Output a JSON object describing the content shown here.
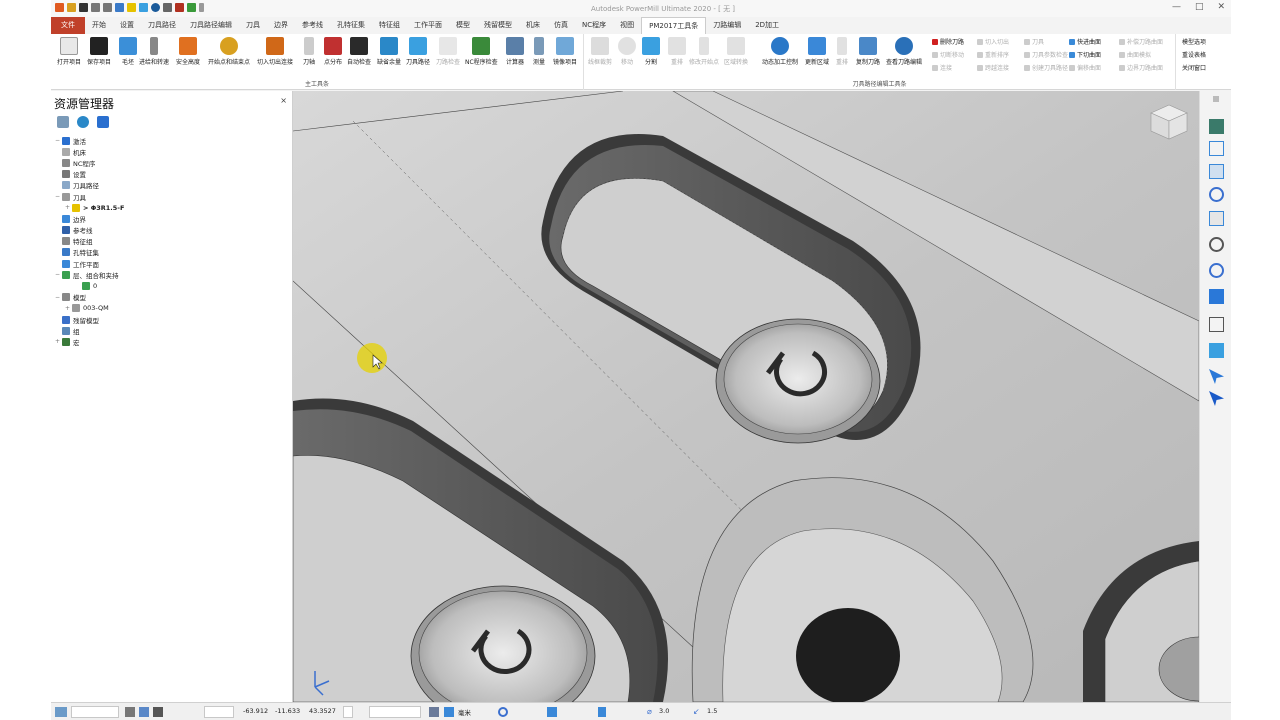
{
  "window": {
    "title": "Autodesk PowerMill Ultimate 2020 - [ 无 ]",
    "buttons": [
      "—",
      "□",
      "✕"
    ]
  },
  "tabs": [
    {
      "label": "文件"
    },
    {
      "label": "开始"
    },
    {
      "label": "设置"
    },
    {
      "label": "刀具路径"
    },
    {
      "label": "刀具路径编辑"
    },
    {
      "label": "刀具"
    },
    {
      "label": "边界"
    },
    {
      "label": "参考线"
    },
    {
      "label": "孔特征集"
    },
    {
      "label": "特征组"
    },
    {
      "label": "工作平面"
    },
    {
      "label": "模型"
    },
    {
      "label": "残留模型"
    },
    {
      "label": "机床"
    },
    {
      "label": "仿真"
    },
    {
      "label": "NC程序"
    },
    {
      "label": "视图"
    },
    {
      "label": "PM2017工具条"
    },
    {
      "label": "刀路编辑"
    },
    {
      "label": "2D加工"
    }
  ],
  "ribbon": {
    "main_group": {
      "label": "主工具条",
      "buttons": [
        {
          "label": "打开项目",
          "color": "#e8e8e8"
        },
        {
          "label": "保存项目",
          "color": "#222222"
        },
        {
          "label": "毛坯",
          "color": "#3b8fd8"
        },
        {
          "label": "进给和转速",
          "color": "#888888"
        },
        {
          "label": "安全高度",
          "color": "#e07020"
        },
        {
          "label": "开始点和结束点",
          "color": "#d8a020"
        },
        {
          "label": "切入切出连接",
          "color": "#d06818"
        },
        {
          "label": "刀轴",
          "color": "#cccccc"
        },
        {
          "label": "点分布",
          "color": "#c03030"
        },
        {
          "label": "自动检查",
          "color": "#2a2a2a"
        },
        {
          "label": "缺省余量",
          "color": "#2a88c8"
        },
        {
          "label": "刀具路径",
          "color": "#3aa0e0"
        },
        {
          "label": "刀路检查",
          "color": "#bbbbbb"
        },
        {
          "label": "NC程序检查",
          "color": "#3a8a3a"
        },
        {
          "label": "计算器",
          "color": "#5a7fa8"
        },
        {
          "label": "测量",
          "color": "#7a9ab8"
        },
        {
          "label": "镜像项目",
          "color": "#70a8d8"
        }
      ]
    },
    "edit_group": {
      "label": "刀具路径编辑工具条",
      "buttons": [
        {
          "label": "线框裁剪"
        },
        {
          "label": "移动"
        },
        {
          "label": "分割"
        },
        {
          "label": "重排"
        },
        {
          "label": "修改开始点"
        },
        {
          "label": "区域转换"
        },
        {
          "label": "动态加工控制"
        },
        {
          "label": "更新区域"
        },
        {
          "label": "重排"
        },
        {
          "label": "复制刀路"
        },
        {
          "label": "查看刀路编辑"
        }
      ],
      "list1": [
        "删除刀路",
        "切断移动",
        "连接"
      ],
      "list2": [
        "切入切出",
        "重新排序",
        "跨越连接"
      ],
      "list3": [
        "刀具",
        "刀具参数检查",
        "创建刀具路径"
      ],
      "list4": [
        "快进曲面",
        "下切曲面",
        "偏移曲面"
      ],
      "list5": [
        "补偿刀路曲面",
        "曲面模拟",
        "边界刀路曲面"
      ]
    },
    "model_list": [
      "模型选项",
      "重设表格",
      "关闭窗口"
    ]
  },
  "explorer": {
    "title": "资源管理器",
    "close": "×",
    "nodes": [
      {
        "label": "激活",
        "toggle": "−",
        "indent": 0,
        "icon": "#2a6fcf"
      },
      {
        "label": "机床",
        "toggle": "",
        "indent": 0,
        "icon": "#aaaaaa"
      },
      {
        "label": "NC程序",
        "toggle": "",
        "indent": 0,
        "icon": "#888888"
      },
      {
        "label": "设置",
        "toggle": "",
        "indent": 0,
        "icon": "#777777"
      },
      {
        "label": "刀具路径",
        "toggle": "",
        "indent": 0,
        "icon": "#8aa8c8"
      },
      {
        "label": "刀具",
        "toggle": "−",
        "indent": 0,
        "icon": "#999999"
      },
      {
        "label": "> Φ3R1.5-F",
        "toggle": "+",
        "indent": 1,
        "icon": "#e6c200"
      },
      {
        "label": "边界",
        "toggle": "",
        "indent": 0,
        "icon": "#3a88d8"
      },
      {
        "label": "参考线",
        "toggle": "",
        "indent": 0,
        "icon": "#3060a8"
      },
      {
        "label": "特征组",
        "toggle": "",
        "indent": 0,
        "icon": "#888888"
      },
      {
        "label": "孔特征集",
        "toggle": "",
        "indent": 0,
        "icon": "#3a7ac8"
      },
      {
        "label": "工作平面",
        "toggle": "",
        "indent": 0,
        "icon": "#3a88d8"
      },
      {
        "label": "层、组合和夹持",
        "toggle": "−",
        "indent": 0,
        "icon": "#3aa050"
      },
      {
        "label": "0",
        "toggle": "",
        "indent": 2,
        "icon": "#3aa050"
      },
      {
        "label": "模型",
        "toggle": "−",
        "indent": 0,
        "icon": "#888888"
      },
      {
        "label": "003-QM",
        "toggle": "+",
        "indent": 1,
        "icon": "#999999"
      },
      {
        "label": "残留模型",
        "toggle": "",
        "indent": 0,
        "icon": "#3a70c8"
      },
      {
        "label": "组",
        "toggle": "",
        "indent": 0,
        "icon": "#5a88b8"
      },
      {
        "label": "宏",
        "toggle": "+",
        "indent": 0,
        "icon": "#3a7a3a"
      }
    ]
  },
  "status": {
    "x": "-63.912",
    "y": "-11.633",
    "z": "43.3527",
    "units": "毫米",
    "diameter": "3.0",
    "stepover": "1.5"
  }
}
